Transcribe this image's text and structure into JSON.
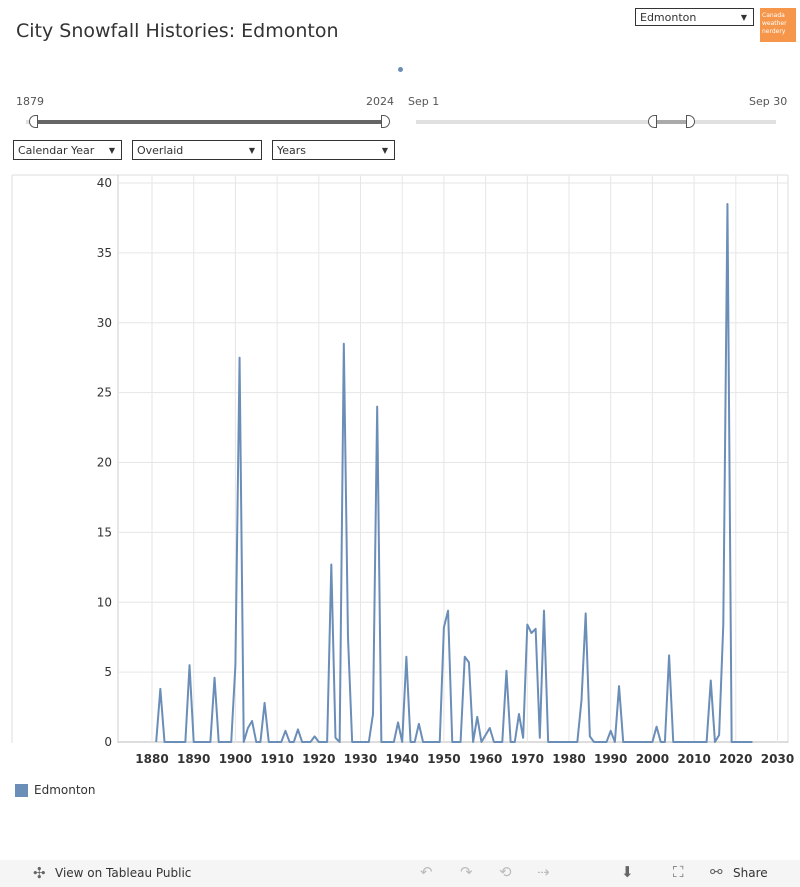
{
  "header": {
    "title": "City Snowfall Histories: Edmonton",
    "city_select": "Edmonton",
    "logo_text": "Canada weather nerdery"
  },
  "controls": {
    "year_start": "1879",
    "year_end": "2024",
    "date_start": "Sep 1",
    "date_end": "Sep 30",
    "year_type": "Calendar Year",
    "mode": "Overlaid",
    "unit": "Years",
    "year_range_fraction": [
      0,
      1
    ],
    "date_range_fraction": [
      0.66,
      0.75
    ]
  },
  "legend": {
    "label": "Edmonton",
    "color": "#6b8eb8"
  },
  "footer": {
    "view_label": "View on Tableau Public",
    "share_label": "Share"
  },
  "chart_data": {
    "type": "line",
    "title": "",
    "xlabel": "",
    "ylabel": "",
    "xlim": [
      1875,
      2032
    ],
    "ylim": [
      0,
      40
    ],
    "xticks": [
      1880,
      1890,
      1900,
      1910,
      1920,
      1930,
      1940,
      1950,
      1960,
      1970,
      1980,
      1990,
      2000,
      2010,
      2020,
      2030
    ],
    "yticks": [
      0,
      5,
      10,
      15,
      20,
      25,
      30,
      35,
      40
    ],
    "grid": true,
    "series": [
      {
        "name": "Edmonton",
        "color": "#6b8eb8",
        "x": [
          1881,
          1882,
          1883,
          1888,
          1889,
          1890,
          1894,
          1895,
          1896,
          1899,
          1900,
          1901,
          1902,
          1903,
          1904,
          1905,
          1906,
          1907,
          1908,
          1911,
          1912,
          1913,
          1914,
          1915,
          1916,
          1918,
          1919,
          1920,
          1922,
          1923,
          1924,
          1925,
          1926,
          1927,
          1928,
          1932,
          1933,
          1934,
          1935,
          1938,
          1939,
          1940,
          1941,
          1942,
          1943,
          1944,
          1945,
          1949,
          1950,
          1951,
          1952,
          1954,
          1955,
          1956,
          1957,
          1958,
          1959,
          1961,
          1962,
          1964,
          1965,
          1966,
          1967,
          1968,
          1969,
          1970,
          1971,
          1972,
          1973,
          1974,
          1975,
          1982,
          1983,
          1984,
          1985,
          1986,
          1989,
          1990,
          1991,
          1992,
          1993,
          2000,
          2001,
          2002,
          2003,
          2004,
          2005,
          2013,
          2014,
          2015,
          2016,
          2017,
          2018,
          2019,
          2024
        ],
        "y": [
          0,
          3.8,
          0,
          0,
          5.5,
          0,
          0,
          4.6,
          0,
          0,
          5.5,
          27.5,
          0,
          1,
          1.5,
          0,
          0,
          2.8,
          0,
          0,
          0.8,
          0,
          0,
          0.9,
          0,
          0,
          0.4,
          0,
          0,
          12.7,
          0.3,
          0,
          28.5,
          7.5,
          0,
          0,
          2,
          24,
          0,
          0,
          1.4,
          0,
          6.1,
          0,
          0,
          1.3,
          0,
          0,
          8.2,
          9.4,
          0,
          0,
          6.1,
          5.7,
          0,
          1.8,
          0,
          1,
          0,
          0,
          5.1,
          0,
          0,
          2,
          0.3,
          8.4,
          7.8,
          8.1,
          0.3,
          9.4,
          0,
          0,
          3,
          9.2,
          0.4,
          0,
          0,
          0.8,
          0,
          4,
          0,
          0,
          1.1,
          0,
          0,
          6.2,
          0,
          0,
          4.4,
          0,
          0.5,
          8.4,
          38.5,
          0,
          0
        ]
      }
    ]
  }
}
